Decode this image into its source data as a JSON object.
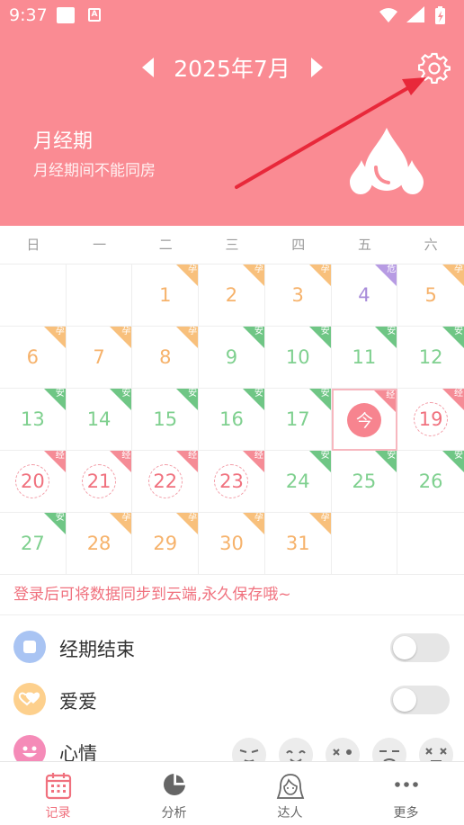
{
  "status_bar": {
    "time": "9:37",
    "a_glyph": "A"
  },
  "header": {
    "month_title": "2025年7月",
    "phase_title": "月经期",
    "phase_subtitle": "月经期间不能同房"
  },
  "weekdays": [
    "日",
    "一",
    "二",
    "三",
    "四",
    "五",
    "六"
  ],
  "calendar": {
    "leading_blanks": 2,
    "trailing_blanks": 2,
    "days": [
      {
        "n": "1",
        "type": "fertile",
        "tag": "孕"
      },
      {
        "n": "2",
        "type": "fertile",
        "tag": "孕"
      },
      {
        "n": "3",
        "type": "fertile",
        "tag": "孕"
      },
      {
        "n": "4",
        "type": "danger",
        "tag": "危"
      },
      {
        "n": "5",
        "type": "fertile",
        "tag": "孕"
      },
      {
        "n": "6",
        "type": "fertile",
        "tag": "孕"
      },
      {
        "n": "7",
        "type": "fertile",
        "tag": "孕"
      },
      {
        "n": "8",
        "type": "fertile",
        "tag": "孕"
      },
      {
        "n": "9",
        "type": "safe",
        "tag": "安"
      },
      {
        "n": "10",
        "type": "safe",
        "tag": "安"
      },
      {
        "n": "11",
        "type": "safe",
        "tag": "安"
      },
      {
        "n": "12",
        "type": "safe",
        "tag": "安"
      },
      {
        "n": "13",
        "type": "safe",
        "tag": "安"
      },
      {
        "n": "14",
        "type": "safe",
        "tag": "安"
      },
      {
        "n": "15",
        "type": "safe",
        "tag": "安"
      },
      {
        "n": "16",
        "type": "safe",
        "tag": "安"
      },
      {
        "n": "17",
        "type": "safe",
        "tag": "安"
      },
      {
        "n": "今",
        "type": "today",
        "tag": "经"
      },
      {
        "n": "19",
        "type": "period",
        "tag": "经"
      },
      {
        "n": "20",
        "type": "period",
        "tag": "经"
      },
      {
        "n": "21",
        "type": "period",
        "tag": "经"
      },
      {
        "n": "22",
        "type": "period",
        "tag": "经"
      },
      {
        "n": "23",
        "type": "period",
        "tag": "经"
      },
      {
        "n": "24",
        "type": "safe",
        "tag": "安"
      },
      {
        "n": "25",
        "type": "safe",
        "tag": "安"
      },
      {
        "n": "26",
        "type": "safe",
        "tag": "安"
      },
      {
        "n": "27",
        "type": "safe",
        "tag": "安"
      },
      {
        "n": "28",
        "type": "fertile",
        "tag": "孕"
      },
      {
        "n": "29",
        "type": "fertile",
        "tag": "孕"
      },
      {
        "n": "30",
        "type": "fertile",
        "tag": "孕"
      },
      {
        "n": "31",
        "type": "fertile",
        "tag": "孕"
      }
    ]
  },
  "login_banner": "登录后可将数据同步到云端,永久保存哦~",
  "records": [
    {
      "label": "经期结束",
      "icon": "square-icon",
      "color": "#a9c4f3",
      "control": "toggle",
      "on": false
    },
    {
      "label": "爱爱",
      "icon": "hearts-icon",
      "color": "#fdd08d",
      "control": "toggle",
      "on": false
    },
    {
      "label": "心情",
      "icon": "smile-icon",
      "color": "#f58bb8",
      "control": "moods"
    }
  ],
  "bottom_nav": [
    {
      "label": "记录",
      "icon": "calendar-icon",
      "active": true
    },
    {
      "label": "分析",
      "icon": "pie-chart-icon",
      "active": false
    },
    {
      "label": "达人",
      "icon": "girl-avatar-icon",
      "active": false
    },
    {
      "label": "更多",
      "icon": "more-dots-icon",
      "active": false
    }
  ],
  "colors": {
    "header_bg": "#fa8b93",
    "fertile": "#f6b26b",
    "safe": "#7fd08f",
    "danger": "#a78bd9",
    "period": "#f0717e",
    "annotation_arrow": "#e8283a"
  }
}
